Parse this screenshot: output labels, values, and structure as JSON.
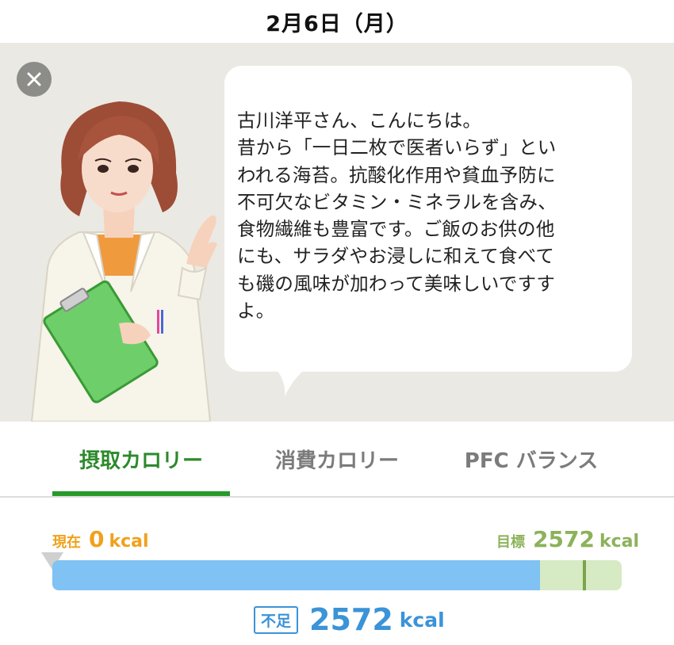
{
  "header": {
    "date": "2月6日（月）"
  },
  "advisor": {
    "message": "古川洋平さん、こんにちは。\n昔から「一日二枚で医者いらず」とい\nわれる海苔。抗酸化作用や貧血予防に\n不可欠なビタミン・ミネラルを含み、\n食物繊維も豊富です。ご飯のお供の他\nにも、サラダやお浸しに和えて食べて\nも磯の風味が加わって美味しいですす\nよ。",
    "close_icon": "close-icon"
  },
  "tabs": [
    {
      "label": "摂取カロリー",
      "active": true
    },
    {
      "label": "消費カロリー",
      "active": false
    },
    {
      "label": "PFC バランス",
      "active": false
    }
  ],
  "calories": {
    "current_label": "現在",
    "current_value": "0",
    "goal_label": "目標",
    "goal_value": "2572",
    "unit": "kcal",
    "progress_fraction": 0.856,
    "goal_marker_fraction": 0.935,
    "deficit_label": "不足",
    "deficit_value": "2572"
  },
  "colors": {
    "accent_green": "#279a2a",
    "current_orange": "#f0a11c",
    "goal_green": "#8cb25a",
    "bar_blue": "#80c2f3",
    "deficit_blue": "#3b93d8"
  }
}
